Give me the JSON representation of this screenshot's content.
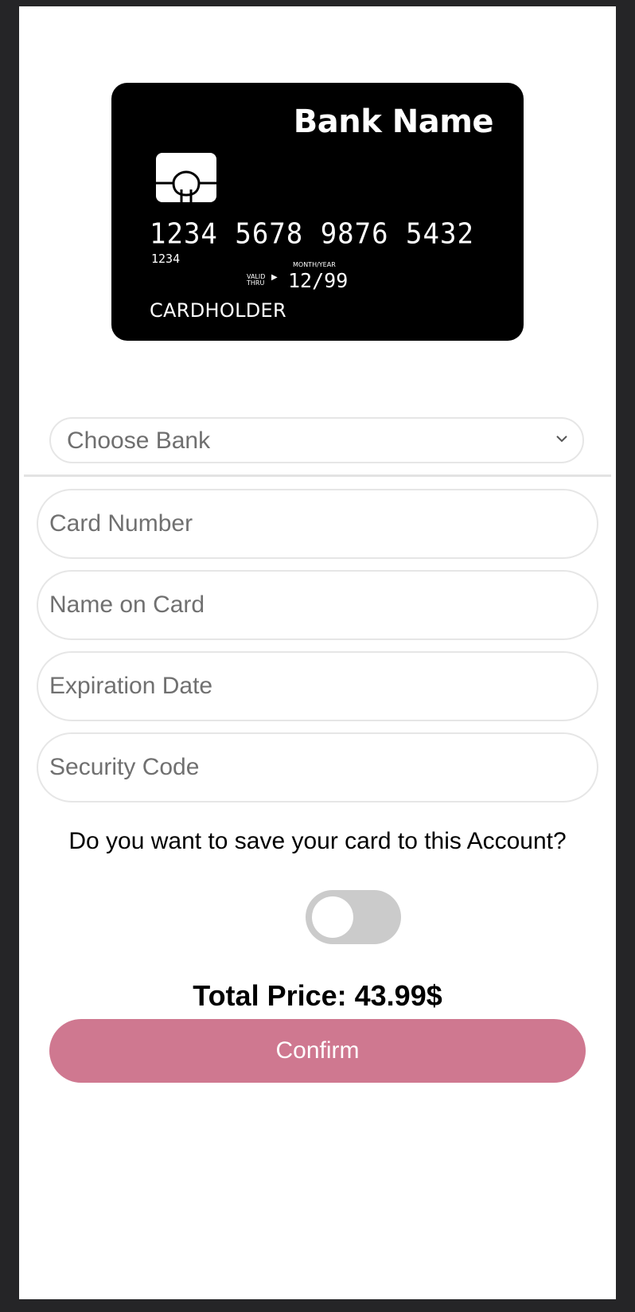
{
  "card": {
    "bank_name": "Bank Name",
    "number": "1234 5678 9876 5432",
    "number_small": "1234",
    "valid_thru": "VALID\nTHRU",
    "month_year": "MONTH/YEAR",
    "expiry": "12/99",
    "holder": "CARDHOLDER",
    "colors": {
      "card": "#000000",
      "text": "#ffffff"
    }
  },
  "form": {
    "bank_select": {
      "placeholder": "Choose Bank",
      "icon": "chevron-down-icon"
    },
    "card_number_placeholder": "Card Number",
    "name_on_card_placeholder": "Name on Card",
    "expiration_date_placeholder": "Expiration Date",
    "security_code_placeholder": "Security Code"
  },
  "save_card": {
    "question": "Do you want to save your card to this Account?",
    "toggle_on": false
  },
  "total": {
    "label": "Total Price: 43.99$"
  },
  "confirm": {
    "label": "Confirm",
    "color": "#cf7890"
  }
}
